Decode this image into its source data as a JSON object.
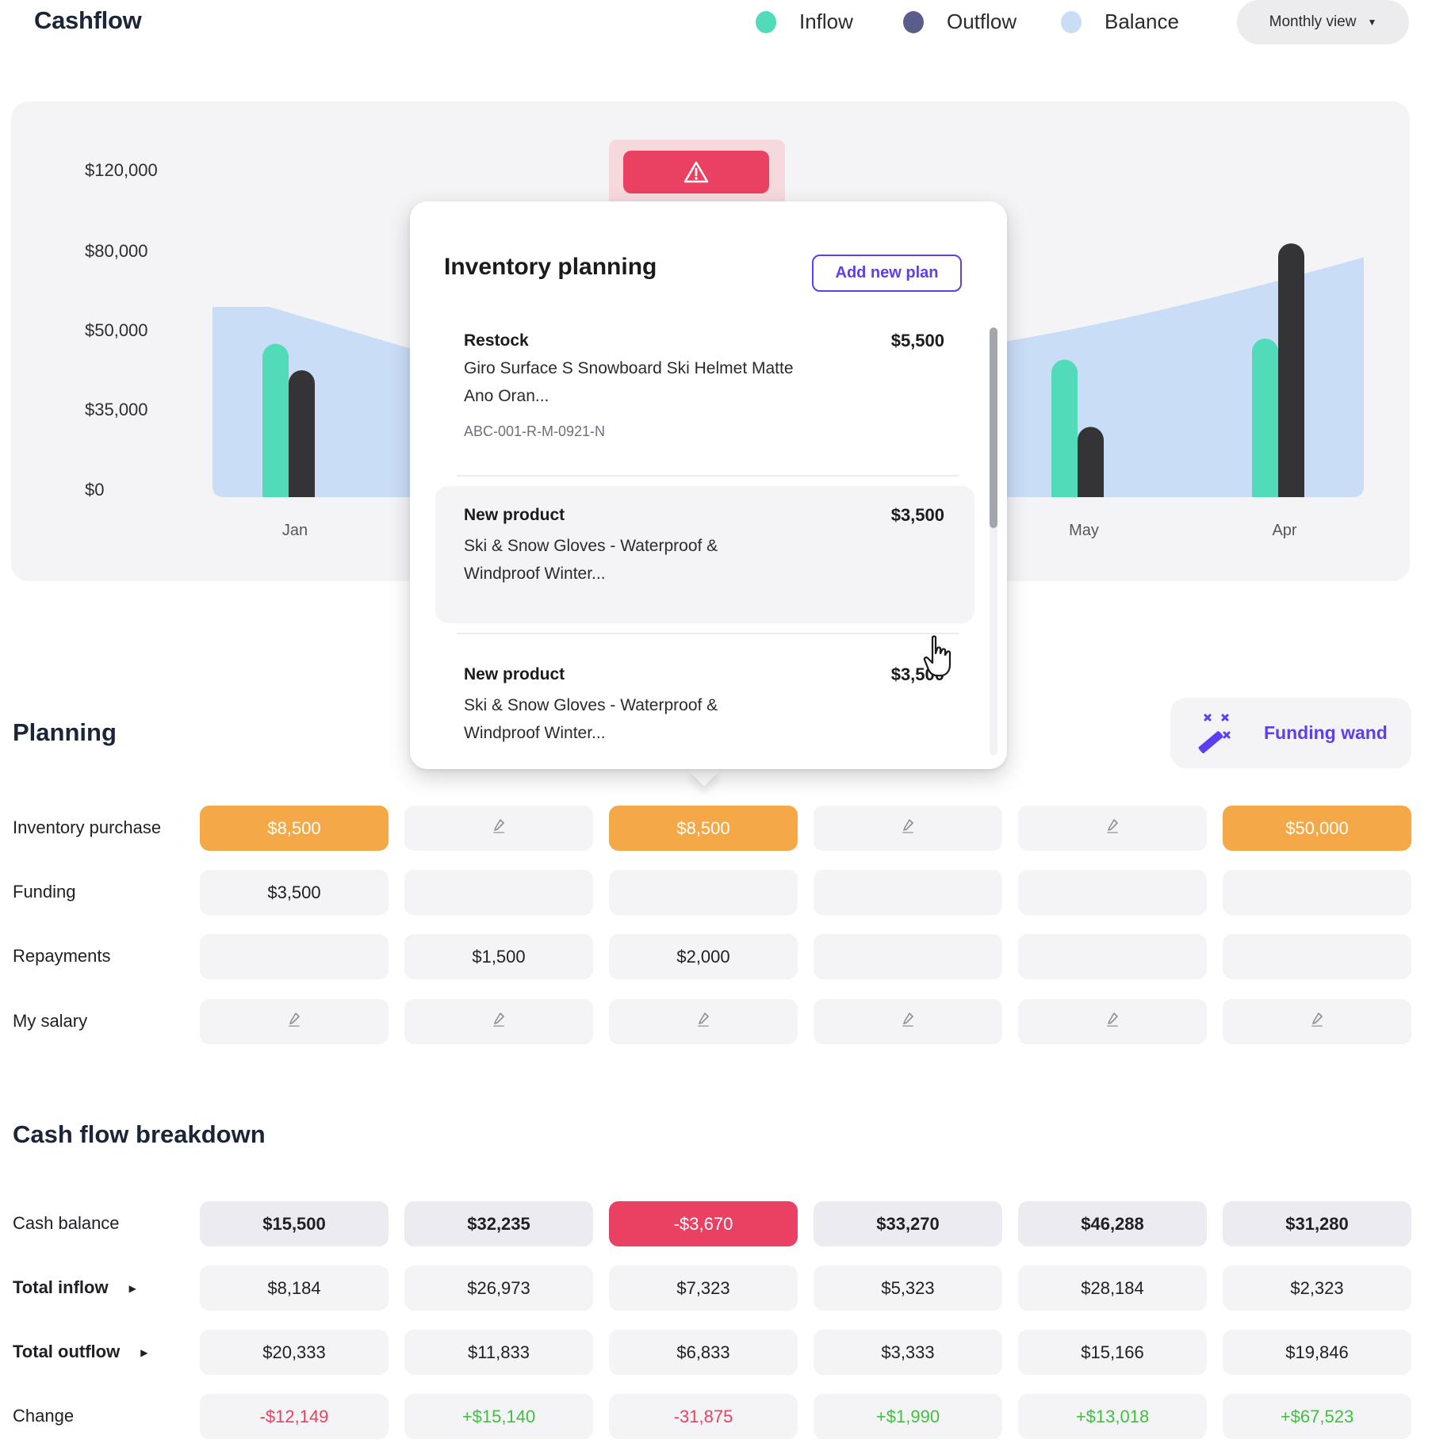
{
  "header": {
    "title": "Cashflow",
    "legend": [
      {
        "label": "Inflow",
        "color": "#52dbb8"
      },
      {
        "label": "Outflow",
        "color": "#5a5d8c"
      },
      {
        "label": "Balance",
        "color": "#c9ddf7"
      }
    ],
    "view_select": {
      "selected": "Monthly view",
      "icon": "caret-down-icon"
    }
  },
  "chart_data": {
    "type": "bar",
    "title": "",
    "xlabel": "",
    "ylabel": "",
    "y_ticks": [
      "$120,000",
      "$80,000",
      "$50,000",
      "$35,000",
      "$0"
    ],
    "y_tick_values": [
      120000,
      80000,
      50000,
      35000,
      0
    ],
    "categories": [
      "Jan",
      "May",
      "Apr"
    ],
    "series": [
      {
        "name": "Inflow",
        "type": "bar",
        "color": "#52dbb8",
        "values": [
          49000,
          46000,
          50000
        ]
      },
      {
        "name": "Outflow",
        "type": "bar",
        "color": "#343437",
        "values": [
          44000,
          31000,
          88000
        ]
      },
      {
        "name": "Balance",
        "type": "area",
        "color": "#c9ddf7",
        "values": [
          62000,
          48000,
          81000
        ]
      }
    ],
    "legend_position": "top-right",
    "grid": false,
    "notes": "Middle months hidden behind popover; warning alert shown on the month with negative balance"
  },
  "alert": {
    "icon": "warning-triangle-icon",
    "color": "#ea4062"
  },
  "popover": {
    "title": "Inventory planning",
    "add_button": "Add new plan",
    "items": [
      {
        "type": "Restock",
        "amount": "$5,500",
        "desc": "Giro Surface S Snowboard Ski Helmet Matte Ano Oran...",
        "sku": "ABC-001-R-M-0921-N"
      },
      {
        "type": "New product",
        "amount": "$3,500",
        "desc": "Ski & Snow Gloves - Waterproof & Windproof Winter...",
        "sku": ""
      },
      {
        "type": "New product",
        "amount": "$3,500",
        "desc": "Ski & Snow Gloves - Waterproof & Windproof Winter...",
        "sku": ""
      }
    ]
  },
  "planning": {
    "title": "Planning",
    "wand_button": "Funding wand",
    "rows": [
      {
        "label": "Inventory purchase",
        "cells": [
          "$8,500",
          "",
          "$8,500",
          "",
          "",
          "$50,000"
        ],
        "styles": [
          "orange",
          "edit",
          "orange",
          "edit",
          "edit",
          "orange"
        ]
      },
      {
        "label": "Funding",
        "cells": [
          "$3,500",
          "",
          "",
          "",
          "",
          ""
        ],
        "styles": [
          "",
          "",
          "",
          "",
          "",
          ""
        ]
      },
      {
        "label": "Repayments",
        "cells": [
          "",
          "$1,500",
          "$2,000",
          "",
          "",
          ""
        ],
        "styles": [
          "",
          "",
          "",
          "",
          "",
          ""
        ]
      },
      {
        "label": "My salary",
        "cells": [
          "",
          "",
          "",
          "",
          "",
          ""
        ],
        "styles": [
          "edit",
          "edit",
          "edit",
          "edit",
          "edit",
          "edit"
        ]
      }
    ]
  },
  "breakdown": {
    "title": "Cash flow breakdown",
    "rows": [
      {
        "label": "Cash balance",
        "bold": false,
        "expandable": false,
        "cells": [
          "$15,500",
          "$32,235",
          "-$3,670",
          "$33,270",
          "$46,288",
          "$31,280"
        ],
        "styles": [
          "balance",
          "balance",
          "negative",
          "balance",
          "balance",
          "balance"
        ]
      },
      {
        "label": "Total inflow",
        "bold": true,
        "expandable": true,
        "cells": [
          "$8,184",
          "$26,973",
          "$7,323",
          "$5,323",
          "$28,184",
          "$2,323"
        ],
        "styles": [
          "",
          "",
          "",
          "",
          "",
          ""
        ]
      },
      {
        "label": "Total outflow",
        "bold": true,
        "expandable": true,
        "cells": [
          "$20,333",
          "$11,833",
          "$6,833",
          "$3,333",
          "$15,166",
          "$19,846"
        ],
        "styles": [
          "",
          "",
          "",
          "",
          "",
          ""
        ]
      },
      {
        "label": "Change",
        "bold": false,
        "expandable": false,
        "cells": [
          "-$12,149",
          "+$15,140",
          "-31,875",
          "+$1,990",
          "+$13,018",
          "+$67,523"
        ],
        "styles": [
          "neg-text",
          "pos-text",
          "neg-text",
          "pos-text",
          "pos-text",
          "pos-text"
        ]
      }
    ]
  }
}
